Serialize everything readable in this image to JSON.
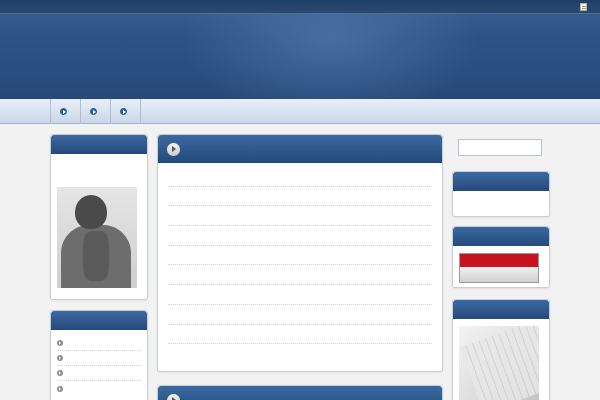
{
  "header": {
    "top_link": "",
    "site_title": "",
    "site_description": ""
  },
  "nav": {
    "items": [
      {
        "label": ""
      },
      {
        "label": ""
      },
      {
        "label": ""
      }
    ]
  },
  "left_sidebar": {
    "profile": {
      "title": "",
      "text": ""
    },
    "categories": {
      "title": "",
      "items": [
        {
          "label": ""
        },
        {
          "label": ""
        },
        {
          "label": ""
        },
        {
          "label": ""
        }
      ]
    }
  },
  "main": {
    "title": "",
    "posts": [
      {
        "title": ""
      },
      {
        "title": ""
      },
      {
        "title": ""
      },
      {
        "title": ""
      },
      {
        "title": ""
      },
      {
        "title": ""
      },
      {
        "title": ""
      },
      {
        "title": ""
      },
      {
        "title": ""
      },
      {
        "title": ""
      }
    ],
    "second_title": ""
  },
  "right_sidebar": {
    "search": {
      "placeholder": ""
    },
    "widget1": {
      "title": "",
      "body": ""
    },
    "widget2": {
      "title": "",
      "rank_top": "",
      "rank_bottom": ""
    },
    "widget3": {
      "title": "",
      "banner_line1": "",
      "banner_line2": "",
      "banner_line3": ""
    }
  },
  "colors": {
    "header_bg": "#2d5384",
    "widget_title_bg": "#24497a",
    "link": "#1d5a9a",
    "rank_red": "#c8141e"
  }
}
